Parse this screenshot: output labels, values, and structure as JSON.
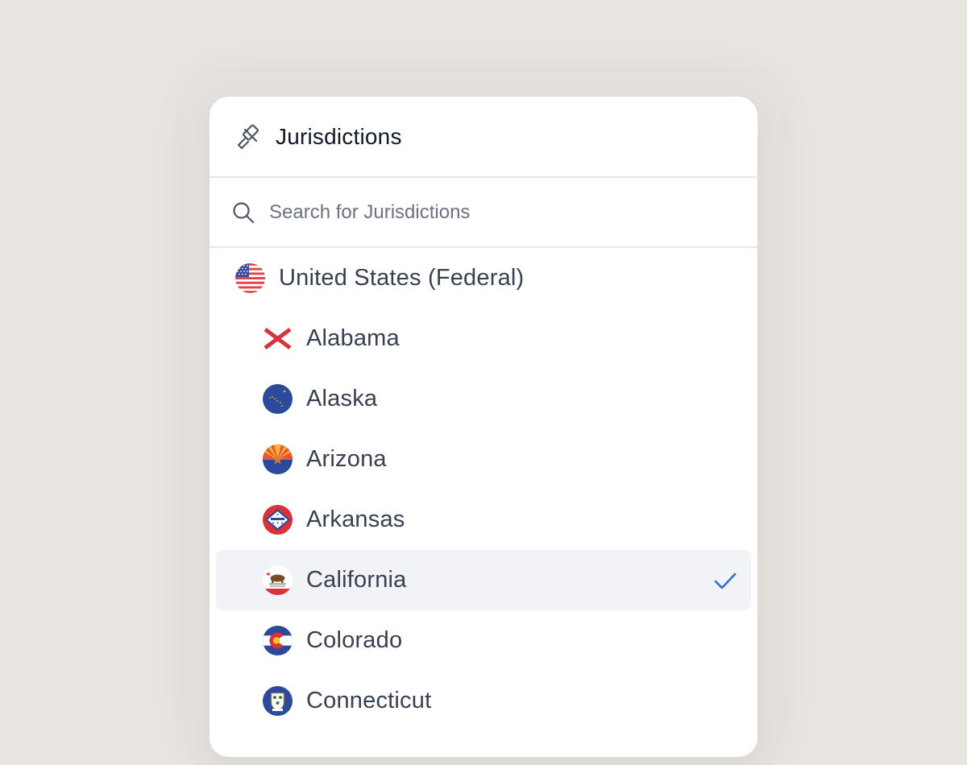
{
  "header": {
    "title": "Jurisdictions",
    "icon": "gavel-icon"
  },
  "search": {
    "placeholder": "Search for Jurisdictions",
    "value": "",
    "icon": "search-icon"
  },
  "items": [
    {
      "label": "United States (Federal)",
      "flag": "us-flag-icon",
      "level": "federal",
      "selected": false
    },
    {
      "label": "Alabama",
      "flag": "alabama-flag-icon",
      "level": "state",
      "selected": false
    },
    {
      "label": "Alaska",
      "flag": "alaska-flag-icon",
      "level": "state",
      "selected": false
    },
    {
      "label": "Arizona",
      "flag": "arizona-flag-icon",
      "level": "state",
      "selected": false
    },
    {
      "label": "Arkansas",
      "flag": "arkansas-flag-icon",
      "level": "state",
      "selected": false
    },
    {
      "label": "California",
      "flag": "california-flag-icon",
      "level": "state",
      "selected": true
    },
    {
      "label": "Colorado",
      "flag": "colorado-flag-icon",
      "level": "state",
      "selected": false
    },
    {
      "label": "Connecticut",
      "flag": "connecticut-flag-icon",
      "level": "state",
      "selected": false
    }
  ],
  "colors": {
    "background": "#e9e6e2",
    "panel": "#ffffff",
    "selected_row": "#f1f3f7",
    "check": "#2f6fd6",
    "text": "#374151",
    "title": "#111827"
  }
}
